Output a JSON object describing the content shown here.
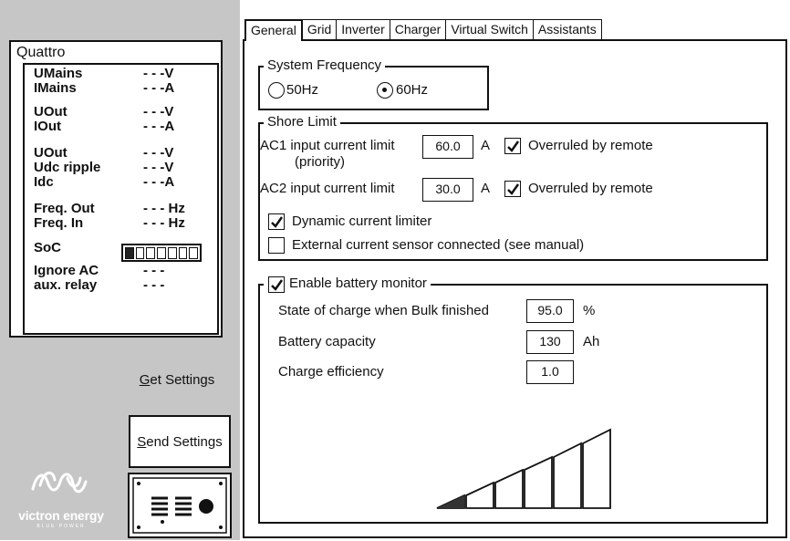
{
  "device": {
    "title": "Quattro",
    "metrics": [
      {
        "label": "UMains",
        "value": "- - -V"
      },
      {
        "label": "IMains",
        "value": "- - -A"
      },
      {
        "label": "UOut",
        "value": "- - -V"
      },
      {
        "label": "IOut",
        "value": "- - -A"
      },
      {
        "label": "UOut",
        "value": "- - -V"
      },
      {
        "label": "Udc ripple",
        "value": "- - -V"
      },
      {
        "label": "Idc",
        "value": "- - -A"
      },
      {
        "label": "Freq. Out",
        "value": "- - - Hz"
      },
      {
        "label": "Freq. In",
        "value": "- - - Hz"
      },
      {
        "label": "SoC",
        "value": ""
      },
      {
        "label": "Ignore AC",
        "value": "- - -"
      },
      {
        "label": "aux. relay",
        "value": "- - -"
      }
    ],
    "soc_segments_total": 7,
    "soc_segments_filled": 1
  },
  "side": {
    "get_settings": {
      "prefix": "G",
      "rest": "et Settings"
    },
    "send_settings": {
      "prefix": "S",
      "rest": "end Settings"
    },
    "logo_text": "victron energy",
    "logo_sub": "BLUE POWER"
  },
  "tabs": [
    "General",
    "Grid",
    "Inverter",
    "Charger",
    "Virtual Switch",
    "Assistants"
  ],
  "active_tab": "General",
  "system_frequency": {
    "legend": "System Frequency",
    "options": [
      "50Hz",
      "60Hz"
    ],
    "selected": "60Hz"
  },
  "shore_limit": {
    "legend": "Shore Limit",
    "ac1": {
      "label": "AC1 input current limit",
      "sublabel": "(priority)",
      "value": "60.0",
      "unit": "A",
      "override_label": "Overruled by remote",
      "override_checked": true
    },
    "ac2": {
      "label": "AC2 input current limit",
      "value": "30.0",
      "unit": "A",
      "override_label": "Overruled by remote",
      "override_checked": true
    },
    "dynamic_limiter": {
      "label": "Dynamic current limiter",
      "checked": true
    },
    "external_sensor": {
      "label": "External current sensor connected (see manual)",
      "checked": false
    }
  },
  "battery_monitor": {
    "legend": "Enable battery monitor",
    "enabled": true,
    "soc_bulk": {
      "label": "State of charge when Bulk finished",
      "value": "95.0",
      "unit": "%"
    },
    "capacity": {
      "label": "Battery capacity",
      "value": "130",
      "unit": "Ah"
    },
    "efficiency": {
      "label": "Charge efficiency",
      "value": "1.0"
    }
  },
  "colors": {
    "panel_gray": "#c6c6c6",
    "border": "#111111"
  }
}
